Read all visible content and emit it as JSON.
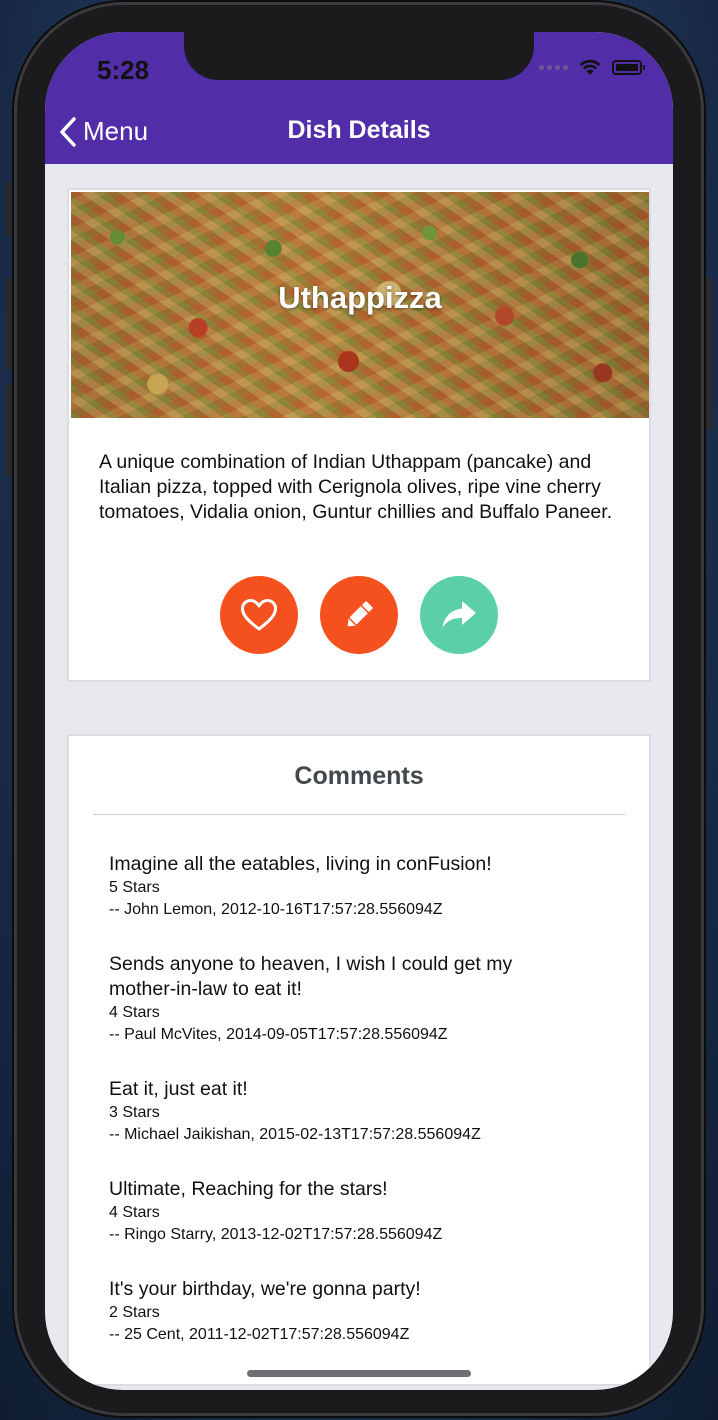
{
  "status_bar": {
    "time": "5:28"
  },
  "nav": {
    "back_label": "Menu",
    "title": "Dish Details"
  },
  "dish": {
    "name": "Uthappizza",
    "description": "A unique combination of Indian Uthappam (pancake) and Italian pizza, topped with Cerignola olives, ripe vine cherry tomatoes, Vidalia onion, Guntur chillies and Buffalo Paneer.",
    "actions": [
      {
        "name": "favorite",
        "icon": "heart-outline-icon",
        "color": "#f4511e"
      },
      {
        "name": "comment",
        "icon": "pencil-icon",
        "color": "#f4511e"
      },
      {
        "name": "share",
        "icon": "share-icon",
        "color": "#5bd0a8"
      }
    ]
  },
  "comments": {
    "title": "Comments",
    "items": [
      {
        "comment": "Imagine all the eatables, living in conFusion!",
        "rating": "5 Stars",
        "byline": "-- John Lemon, 2012-10-16T17:57:28.556094Z"
      },
      {
        "comment": "Sends anyone to heaven, I wish I could get my mother-in-law to eat it!",
        "rating": "4 Stars",
        "byline": "-- Paul McVites, 2014-09-05T17:57:28.556094Z"
      },
      {
        "comment": "Eat it, just eat it!",
        "rating": "3 Stars",
        "byline": "-- Michael Jaikishan, 2015-02-13T17:57:28.556094Z"
      },
      {
        "comment": "Ultimate, Reaching for the stars!",
        "rating": "4 Stars",
        "byline": "-- Ringo Starry, 2013-12-02T17:57:28.556094Z"
      },
      {
        "comment": "It's your birthday, we're gonna party!",
        "rating": "2 Stars",
        "byline": "-- 25 Cent, 2011-12-02T17:57:28.556094Z"
      }
    ]
  },
  "colors": {
    "header": "#512da8",
    "accent": "#f4511e",
    "share": "#5bd0a8"
  }
}
